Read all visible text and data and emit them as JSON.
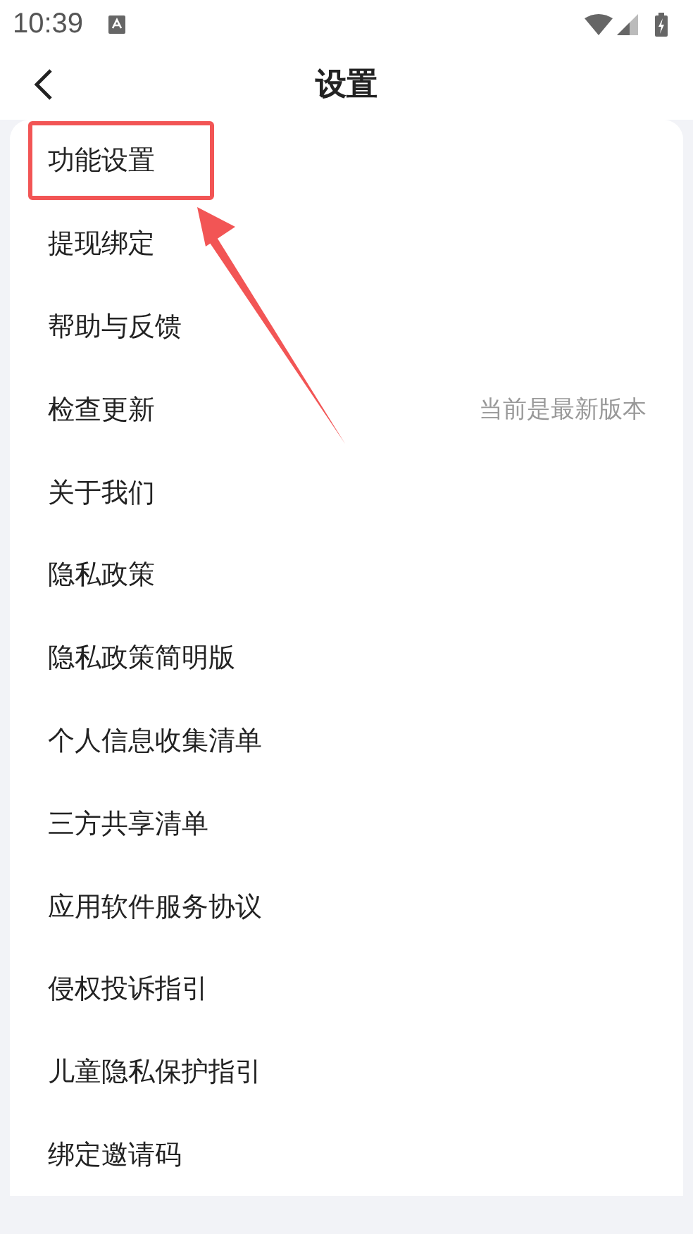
{
  "status_bar": {
    "time": "10:39"
  },
  "header": {
    "title": "设置"
  },
  "items": [
    {
      "label": "功能设置",
      "highlighted": true
    },
    {
      "label": "提现绑定",
      "highlighted": false
    },
    {
      "label": "帮助与反馈",
      "highlighted": false
    },
    {
      "label": "检查更新",
      "highlighted": false,
      "value": "当前是最新版本"
    },
    {
      "label": "关于我们",
      "highlighted": false
    },
    {
      "label": "隐私政策",
      "highlighted": false
    },
    {
      "label": "隐私政策简明版",
      "highlighted": false
    },
    {
      "label": "个人信息收集清单",
      "highlighted": false
    },
    {
      "label": "三方共享清单",
      "highlighted": false
    },
    {
      "label": "应用软件服务协议",
      "highlighted": false
    },
    {
      "label": "侵权投诉指引",
      "highlighted": false
    },
    {
      "label": "儿童隐私保护指引",
      "highlighted": false
    },
    {
      "label": "绑定邀请码",
      "highlighted": false
    }
  ]
}
